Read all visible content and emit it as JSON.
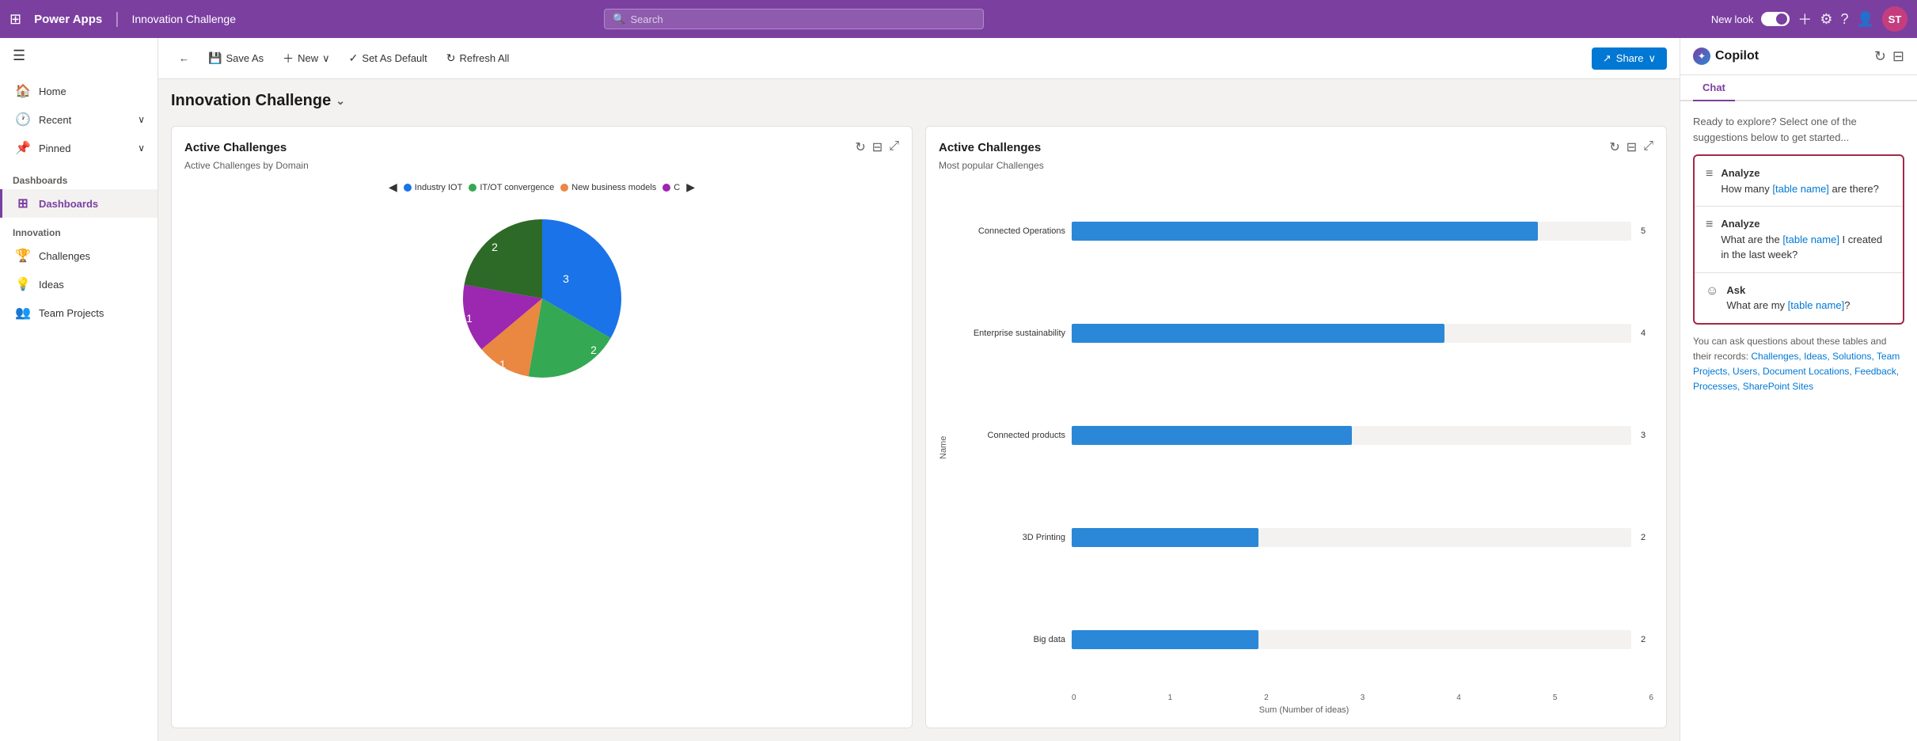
{
  "topNav": {
    "appName": "Power Apps",
    "divider": "|",
    "pageName": "Innovation Challenge",
    "searchPlaceholder": "Search",
    "newLookLabel": "New look",
    "avatarInitials": "ST"
  },
  "sidebar": {
    "hamburgerIcon": "☰",
    "items": [
      {
        "label": "Home",
        "icon": "🏠",
        "expandable": false
      },
      {
        "label": "Recent",
        "icon": "🕐",
        "expandable": true
      },
      {
        "label": "Pinned",
        "icon": "📌",
        "expandable": true
      }
    ],
    "sections": [
      {
        "label": "Dashboards",
        "items": [
          {
            "label": "Dashboards",
            "icon": "⊞",
            "active": true
          }
        ]
      },
      {
        "label": "Innovation",
        "items": [
          {
            "label": "Challenges",
            "icon": "🏆",
            "active": false
          },
          {
            "label": "Ideas",
            "icon": "💡",
            "active": false
          },
          {
            "label": "Team Projects",
            "icon": "👥",
            "active": false
          }
        ]
      }
    ]
  },
  "toolbar": {
    "backIcon": "←",
    "saveAsLabel": "Save As",
    "newLabel": "New",
    "setAsDefaultLabel": "Set As Default",
    "refreshAllLabel": "Refresh All",
    "shareLabel": "Share"
  },
  "dashboard": {
    "title": "Innovation Challenge",
    "chevron": "⌄"
  },
  "pieChart": {
    "title": "Active Challenges",
    "subtitle": "Active Challenges by Domain",
    "legend": [
      {
        "label": "Industry IOT",
        "color": "#1a73e8"
      },
      {
        "label": "IT/OT convergence",
        "color": "#34a853"
      },
      {
        "label": "New business models",
        "color": "#ea8741"
      },
      {
        "label": "C",
        "color": "#9c27b0"
      }
    ],
    "segments": [
      {
        "label": "3",
        "color": "#1a73e8",
        "value": 3,
        "startAngle": 0,
        "endAngle": 120
      },
      {
        "label": "2",
        "color": "#34a853",
        "value": 2,
        "startAngle": 120,
        "endAngle": 200
      },
      {
        "label": "1",
        "color": "#ea8741",
        "value": 1,
        "startAngle": 200,
        "endAngle": 240
      },
      {
        "label": "1",
        "color": "#9c27b0",
        "value": 1,
        "startAngle": 240,
        "endAngle": 280
      },
      {
        "label": "2",
        "color": "#c0392b",
        "value": 2,
        "startAngle": 280,
        "endAngle": 360
      }
    ]
  },
  "barChart": {
    "title": "Active Challenges",
    "subtitle": "Most popular Challenges",
    "xAxisLabel": "Sum (Number of ideas)",
    "bars": [
      {
        "label": "Connected Operations",
        "value": 5,
        "maxValue": 6
      },
      {
        "label": "Enterprise sustainability",
        "value": 4,
        "maxValue": 6
      },
      {
        "label": "Connected products",
        "value": 3,
        "maxValue": 6
      },
      {
        "label": "3D Printing",
        "value": 2,
        "maxValue": 6
      },
      {
        "label": "Big data",
        "value": 2,
        "maxValue": 6
      }
    ],
    "xAxisTicks": [
      "0",
      "1",
      "2",
      "3",
      "4",
      "5",
      "6"
    ]
  },
  "copilot": {
    "title": "Copilot",
    "tabs": [
      "Chat"
    ],
    "introText": "Ready to explore? Select one of the suggestions below to get started...",
    "suggestions": [
      {
        "icon": "≡",
        "type": "Analyze",
        "text": "How many [table name] are there?"
      },
      {
        "icon": "≡",
        "type": "Analyze",
        "text": "What are the [table name] I created in the last week?"
      },
      {
        "icon": "☺",
        "type": "Ask",
        "text": "What are my [table name]?"
      }
    ],
    "footerText": "You can ask questions about these tables and their records: Challenges, Ideas, Solutions, Team Projects, Users, Document Locations, Feedback, Processes, SharePoint Sites"
  }
}
